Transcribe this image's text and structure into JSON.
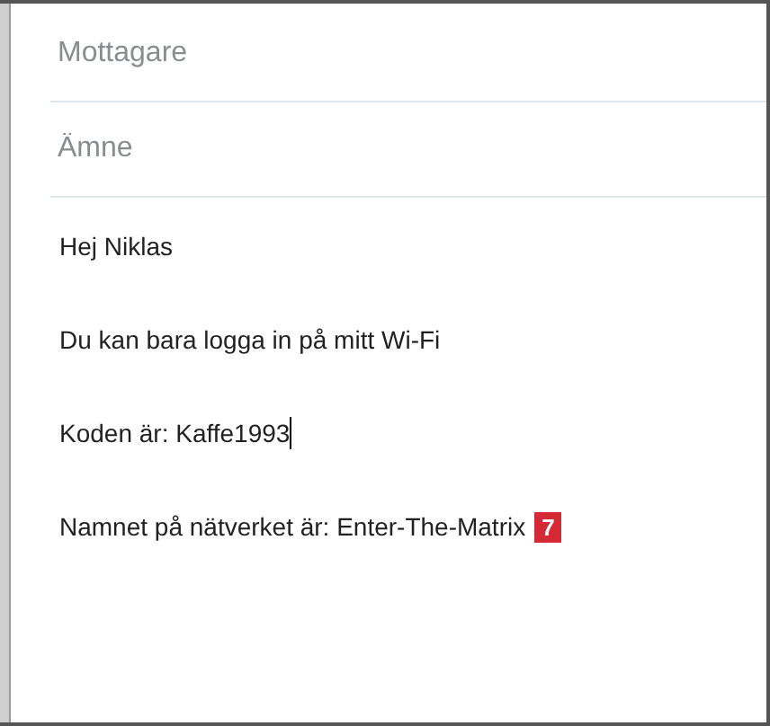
{
  "recipient_field": {
    "placeholder": "Mottagare"
  },
  "subject_field": {
    "placeholder": "Ämne"
  },
  "body_lines": [
    {
      "text": "Hej Niklas",
      "cursor": false
    },
    {
      "text": "Du kan bara logga in på mitt Wi-Fi",
      "cursor": false
    },
    {
      "text": "Koden är: Kaffe1993",
      "cursor": true
    },
    {
      "text": "Namnet på nätverket är: Enter-The-Matrix",
      "cursor": false,
      "badge": "7"
    }
  ]
}
